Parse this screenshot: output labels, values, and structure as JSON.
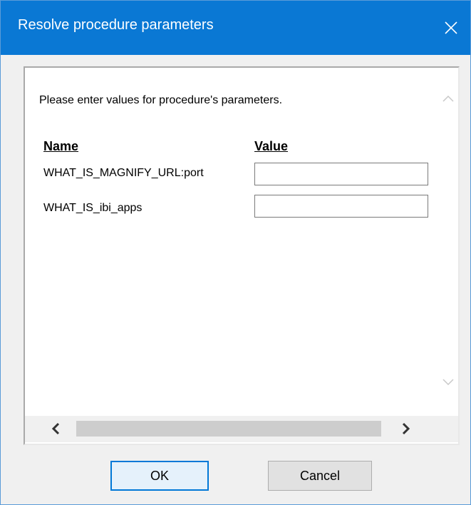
{
  "window": {
    "title": "Resolve procedure parameters",
    "title_bar_color": "#0a78d4",
    "close_icon": "close-icon"
  },
  "panel": {
    "intro": "Please enter values for procedure's parameters.",
    "columns": {
      "name": "Name",
      "value": "Value"
    },
    "parameters": [
      {
        "name": "WHAT_IS_MAGNIFY_URL:port",
        "value": ""
      },
      {
        "name": "WHAT_IS_ibi_apps",
        "value": ""
      }
    ],
    "scrollbars": {
      "vertical": {
        "up_icon": "chevron-up-icon",
        "down_icon": "chevron-down-icon"
      },
      "horizontal": {
        "left_icon": "chevron-left-icon",
        "right_icon": "chevron-right-icon"
      }
    }
  },
  "buttons": {
    "ok": "OK",
    "cancel": "Cancel"
  },
  "colors": {
    "accent": "#0078d7"
  }
}
